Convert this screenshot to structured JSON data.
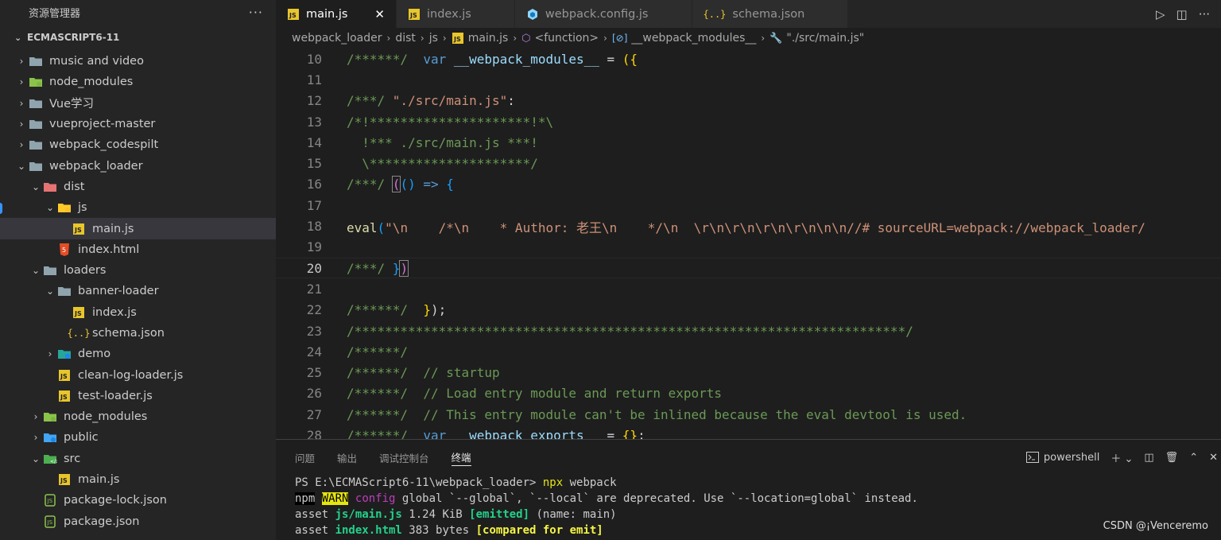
{
  "sidebar": {
    "header_title": "资源管理器",
    "more_label": "···",
    "project_name": "ECMASCRIPT6-11",
    "items": [
      {
        "label": "music and video",
        "depth": 1,
        "type": "folder",
        "expanded": false
      },
      {
        "label": "node_modules",
        "depth": 1,
        "type": "node-folder",
        "expanded": false
      },
      {
        "label": "Vue学习",
        "depth": 1,
        "type": "folder",
        "expanded": false
      },
      {
        "label": "vueproject-master",
        "depth": 1,
        "type": "folder",
        "expanded": false
      },
      {
        "label": "webpack_codespilt",
        "depth": 1,
        "type": "folder",
        "expanded": false
      },
      {
        "label": "webpack_loader",
        "depth": 1,
        "type": "folder",
        "expanded": true
      },
      {
        "label": "dist",
        "depth": 2,
        "type": "dist-folder",
        "expanded": true
      },
      {
        "label": "js",
        "depth": 3,
        "type": "js-folder",
        "expanded": true
      },
      {
        "label": "main.js",
        "depth": 4,
        "type": "js-file",
        "selected": true
      },
      {
        "label": "index.html",
        "depth": 3,
        "type": "html-file"
      },
      {
        "label": "loaders",
        "depth": 2,
        "type": "folder",
        "expanded": true
      },
      {
        "label": "banner-loader",
        "depth": 3,
        "type": "folder",
        "expanded": true
      },
      {
        "label": "index.js",
        "depth": 4,
        "type": "js-file"
      },
      {
        "label": "schema.json",
        "depth": 4,
        "type": "json-file"
      },
      {
        "label": "demo",
        "depth": 3,
        "type": "demo-folder",
        "expanded": false
      },
      {
        "label": "clean-log-loader.js",
        "depth": 3,
        "type": "js-file"
      },
      {
        "label": "test-loader.js",
        "depth": 3,
        "type": "js-file"
      },
      {
        "label": "node_modules",
        "depth": 2,
        "type": "node-folder",
        "expanded": false
      },
      {
        "label": "public",
        "depth": 2,
        "type": "public-folder",
        "expanded": false
      },
      {
        "label": "src",
        "depth": 2,
        "type": "src-folder",
        "expanded": true
      },
      {
        "label": "main.js",
        "depth": 3,
        "type": "js-file"
      },
      {
        "label": "package-lock.json",
        "depth": 2,
        "type": "pkg-file"
      },
      {
        "label": "package.json",
        "depth": 2,
        "type": "pkg-file"
      }
    ]
  },
  "tabs": [
    {
      "label": "main.js",
      "icon": "js",
      "active": true,
      "close": "✕"
    },
    {
      "label": "index.js",
      "icon": "js",
      "active": false
    },
    {
      "label": "webpack.config.js",
      "icon": "webpack",
      "active": false
    },
    {
      "label": "schema.json",
      "icon": "json",
      "active": false
    }
  ],
  "breadcrumb": {
    "items": [
      "webpack_loader",
      "dist",
      "js",
      "main.js",
      "<function>",
      "__webpack_modules__",
      "\"./src/main.js\""
    ],
    "icons": [
      "",
      "",
      "",
      "js",
      "cube",
      "bracket",
      "wrench"
    ]
  },
  "editor": {
    "lines": [
      {
        "n": "10",
        "spans": [
          [
            "c",
            "/******/  "
          ],
          [
            "k",
            "var "
          ],
          [
            "v",
            "__webpack_modules__"
          ],
          [
            "p",
            " = "
          ],
          [
            "b1",
            "({"
          ]
        ]
      },
      {
        "n": "11",
        "spans": []
      },
      {
        "n": "12",
        "spans": [
          [
            "c",
            "/***/ "
          ],
          [
            "s",
            "\"./src/main.js\""
          ],
          [
            "p",
            ":"
          ]
        ]
      },
      {
        "n": "13",
        "spans": [
          [
            "c",
            "/*!*********************!*\\"
          ]
        ]
      },
      {
        "n": "14",
        "spans": [
          [
            "c",
            "  !*** ./src/main.js ***!"
          ]
        ]
      },
      {
        "n": "15",
        "spans": [
          [
            "c",
            "  \\*********************/"
          ]
        ]
      },
      {
        "n": "16",
        "spans": [
          [
            "c",
            "/***/ "
          ],
          [
            "b2box",
            "("
          ],
          [
            "b3",
            "()"
          ],
          [
            "p",
            " "
          ],
          [
            "k",
            "=>"
          ],
          [
            "p",
            " "
          ],
          [
            "b3",
            "{"
          ]
        ]
      },
      {
        "n": "17",
        "spans": []
      },
      {
        "n": "18",
        "spans": [
          [
            "f",
            "eval"
          ],
          [
            "b3",
            "("
          ],
          [
            "s",
            "\"\\n    /*\\n    * Author: 老王\\n    */\\n  \\r\\n\\r\\n\\r\\n\\r\\n\\n\\n//# sourceURL=webpack://webpack_loader/"
          ]
        ]
      },
      {
        "n": "19",
        "spans": []
      },
      {
        "n": "20",
        "spans": [
          [
            "c",
            "/***/ "
          ],
          [
            "b3",
            "}"
          ],
          [
            "b2box",
            ")"
          ]
        ],
        "current": true
      },
      {
        "n": "21",
        "spans": []
      },
      {
        "n": "22",
        "spans": [
          [
            "c",
            "/******/  "
          ],
          [
            "b1",
            "}"
          ],
          [
            "p",
            ");"
          ]
        ]
      },
      {
        "n": "23",
        "spans": [
          [
            "c",
            "/************************************************************************/"
          ]
        ]
      },
      {
        "n": "24",
        "spans": [
          [
            "c",
            "/******/"
          ]
        ]
      },
      {
        "n": "25",
        "spans": [
          [
            "c",
            "/******/  // startup"
          ]
        ]
      },
      {
        "n": "26",
        "spans": [
          [
            "c",
            "/******/  // Load entry module and return exports"
          ]
        ]
      },
      {
        "n": "27",
        "spans": [
          [
            "c",
            "/******/  // This entry module can't be inlined because the eval devtool is used."
          ]
        ]
      },
      {
        "n": "28",
        "spans": [
          [
            "c",
            "/******/  "
          ],
          [
            "k",
            "var "
          ],
          [
            "v",
            "__webpack_exports__"
          ],
          [
            "p",
            " = "
          ],
          [
            "b1",
            "{}"
          ],
          [
            "p",
            ";"
          ]
        ]
      }
    ]
  },
  "panel": {
    "tabs": [
      "问题",
      "输出",
      "调试控制台",
      "终端"
    ],
    "active_tab": "终端",
    "shell_label": "powershell",
    "terminal_lines": [
      [
        [
          "n",
          "PS E:\\ECMAScript6-11\\webpack_loader> "
        ],
        [
          "cmd",
          "npx "
        ],
        [
          "n",
          "webpack"
        ]
      ],
      [
        [
          "npm",
          "npm"
        ],
        [
          "n",
          " "
        ],
        [
          "warn",
          "WARN"
        ],
        [
          "n",
          " "
        ],
        [
          "mag",
          "config"
        ],
        [
          "n",
          " global `--global`, `--local` are deprecated. Use `--location=global` instead."
        ]
      ],
      [
        [
          "n",
          "asset "
        ],
        [
          "green",
          "js/main.js"
        ],
        [
          "n",
          " 1.24 KiB "
        ],
        [
          "green",
          "[emitted]"
        ],
        [
          "n",
          " (name: main)"
        ]
      ],
      [
        [
          "n",
          "asset "
        ],
        [
          "green",
          "index.html"
        ],
        [
          "n",
          " 383 bytes "
        ],
        [
          "yb",
          "[compared for emit]"
        ]
      ]
    ]
  },
  "watermark": "CSDN @¡Venceremo",
  "colors": {
    "accent": "#007acc",
    "js_icon": "#e8c62c",
    "json_icon": "#e8c62c",
    "html_icon": "#e44d26"
  }
}
